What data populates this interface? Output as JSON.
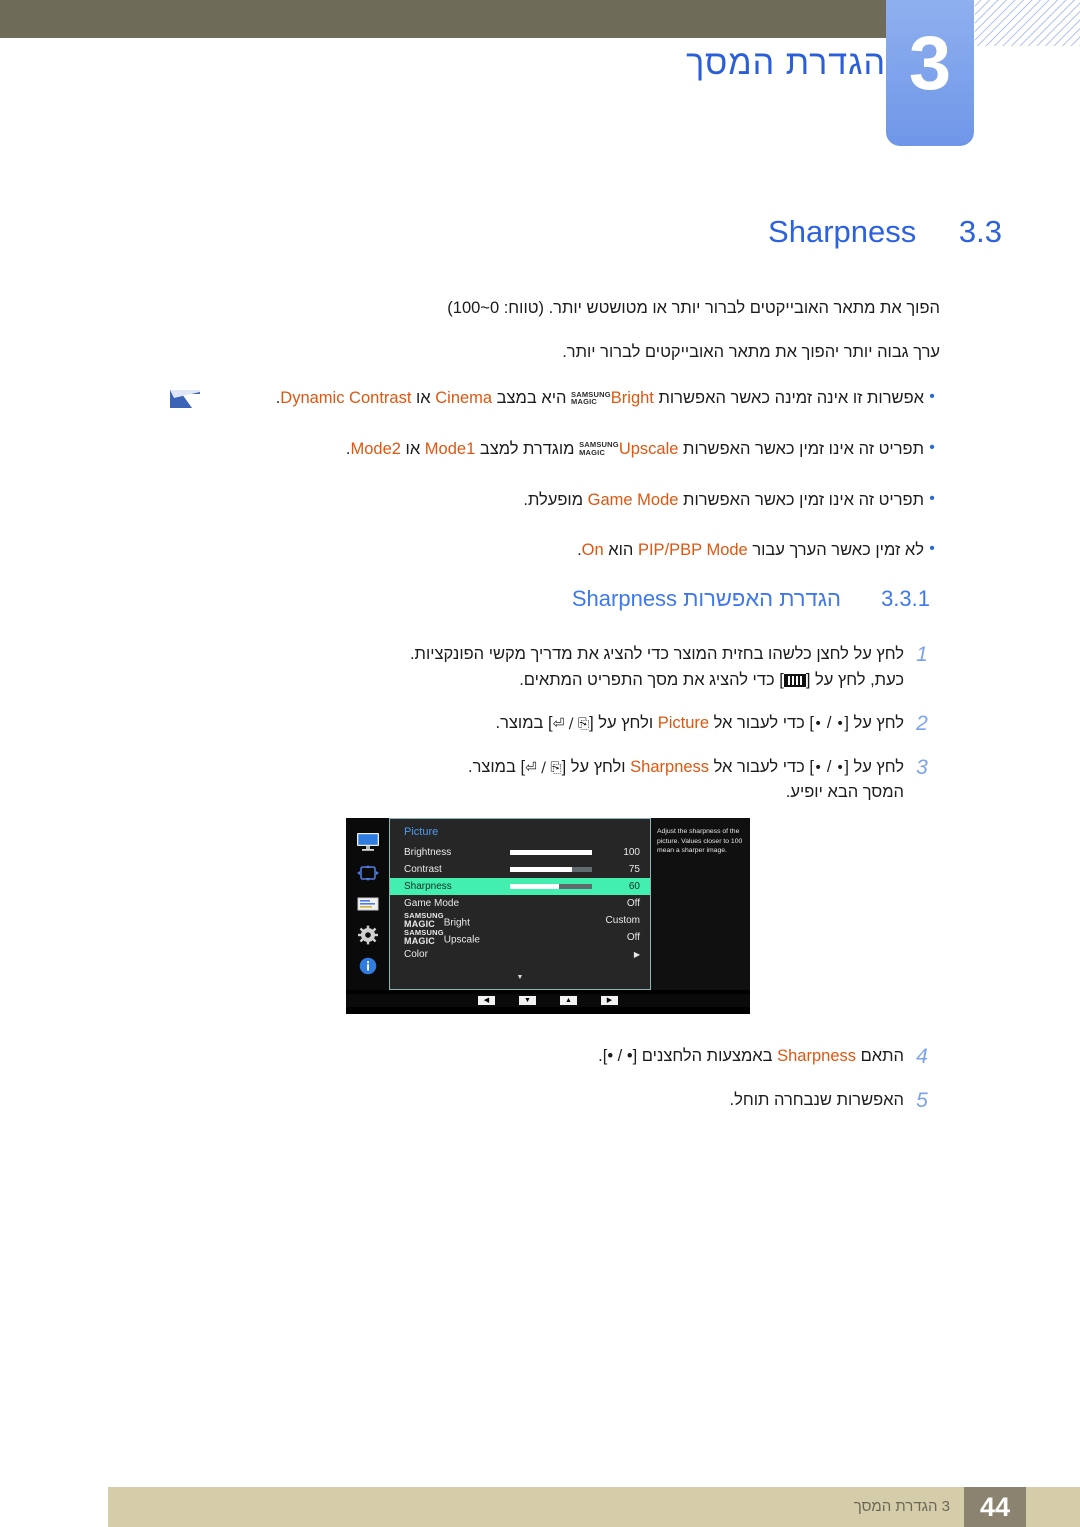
{
  "header": {
    "chapter_number": "3",
    "chapter_title": "הגדרת המסך"
  },
  "section": {
    "number": "3.3",
    "title": "Sharpness"
  },
  "intro": {
    "paragraph1": "הפוך את מתאר האובייקטים לברור יותר או מטושטש יותר. (טווח: 0~100)",
    "paragraph2": "ערך גבוה יותר יהפוך את מתאר האובייקטים לברור יותר."
  },
  "notes": [
    {
      "bullet": "•",
      "pre": "אפשרות זו אינה זמינה כאשר האפשרות ",
      "magic_small_top": "SAMSUNG",
      "magic_small_bottom": "MAGIC",
      "magic_word": "Bright",
      "mid": " היא במצב ",
      "kw1": "Cinema",
      "join": " או ",
      "kw2": "Dynamic Contrast",
      "post": "."
    },
    {
      "bullet": "•",
      "pre": "תפריט זה אינו זמין כאשר האפשרות ",
      "magic_small_top": "SAMSUNG",
      "magic_small_bottom": "MAGIC",
      "magic_word": "Upscale",
      "mid": " מוגדרת למצב ",
      "kw1": "Mode1",
      "join": " או ",
      "kw2": "Mode2",
      "post": "."
    },
    {
      "bullet": "•",
      "pre": "תפריט זה אינו זמין כאשר האפשרות ",
      "kw1": "Game Mode",
      "post": " מופעלת."
    },
    {
      "bullet": "•",
      "pre": "לא זמין כאשר הערך עבור ",
      "kw1": "PIP/PBP Mode",
      "mid": " הוא ",
      "kw2": "On",
      "post": "."
    }
  ],
  "subsection": {
    "number": "3.3.1",
    "title_he": "הגדרת האפשרות",
    "title_en": "Sharpness"
  },
  "steps": [
    {
      "num": "1",
      "line1": "לחץ על לחצן כלשהו בחזית המוצר כדי להציג את מדריך מקשי הפונקציות.",
      "line2_pre": "כעת, לחץ על [",
      "line2_key": "bars-icon",
      "line2_post": "] כדי להציג את מסך התפריט המתאים."
    },
    {
      "num": "2",
      "pre": "לחץ על [",
      "key1": "•",
      "mid1": " / ",
      "key2": "•",
      "mid2": "] כדי לעבור אל ",
      "kw": "Picture",
      "mid3": " ולחץ על [",
      "key3": "⏎ / ⎘",
      "post": "] במוצר."
    },
    {
      "num": "3",
      "pre": "לחץ על [",
      "key1": "•",
      "mid1": " / ",
      "key2": "•",
      "mid2": "] כדי לעבור אל ",
      "kw": "Sharpness",
      "mid3": " ולחץ על [",
      "key3": "⏎ / ⎘",
      "post": "] במוצר.",
      "line2": "המסך הבא יופיע."
    }
  ],
  "steps_after": [
    {
      "num": "4",
      "pre": "התאם ",
      "kw": "Sharpness",
      "post": " באמצעות הלחצנים [• / •]."
    },
    {
      "num": "5",
      "pre": "האפשרות שנבחרה תוחל."
    }
  ],
  "osd": {
    "title": "Picture",
    "sidebar_icons": [
      "monitor-icon",
      "dpad-icon",
      "list-icon",
      "gear-icon",
      "info-icon"
    ],
    "rows": [
      {
        "label": "Brightness",
        "value": "100",
        "slider": 100,
        "selected": false,
        "type": "slider"
      },
      {
        "label": "Contrast",
        "value": "75",
        "slider": 75,
        "selected": false,
        "type": "slider"
      },
      {
        "label": "Sharpness",
        "value": "60",
        "slider": 60,
        "selected": true,
        "type": "slider"
      },
      {
        "label": "Game Mode",
        "value": "Off",
        "selected": false,
        "type": "value"
      },
      {
        "label_magic_top": "SAMSUNG",
        "label_magic_bottom": "MAGIC",
        "label": "Bright",
        "value": "Custom",
        "selected": false,
        "type": "magic"
      },
      {
        "label_magic_top": "SAMSUNG",
        "label_magic_bottom": "MAGIC",
        "label": "Upscale",
        "value": "Off",
        "selected": false,
        "type": "magic"
      },
      {
        "label": "Color",
        "value": "▶",
        "selected": false,
        "type": "submenu"
      }
    ],
    "scroll_caret": "▼",
    "description": "Adjust the sharpness of the picture. Values closer to 100 mean a sharper image.",
    "bottom_keys": [
      "◀",
      "▼",
      "▲",
      "▶"
    ]
  },
  "footer": {
    "page_number": "44",
    "text": "3 הגדרת המסך"
  },
  "colors": {
    "accent_blue": "#2c62e0",
    "link_blue": "#3f78ee",
    "keyword_orange": "#e0560f",
    "olive": "#6e6c58",
    "footer_tan": "#d5cca9",
    "footer_page_box": "#8c8270",
    "osd_highlight": "#43efae"
  }
}
